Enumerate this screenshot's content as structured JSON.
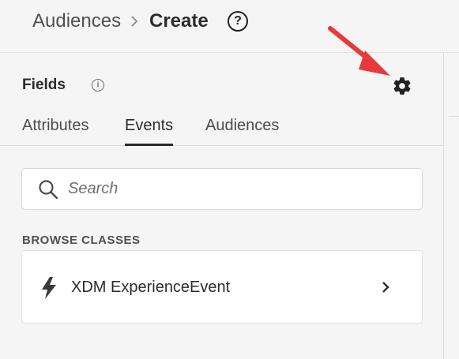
{
  "breadcrumb": {
    "parent": "Audiences",
    "separator_icon": "chevron-right-icon",
    "current": "Create",
    "help_icon": "?"
  },
  "panel": {
    "title": "Fields",
    "info_icon": "i",
    "settings_icon": "gear-icon"
  },
  "tabs": [
    {
      "label": "Attributes",
      "active": false
    },
    {
      "label": "Events",
      "active": true
    },
    {
      "label": "Audiences",
      "active": false
    }
  ],
  "search": {
    "placeholder": "Search",
    "value": ""
  },
  "browse": {
    "section_label": "BROWSE CLASSES",
    "items": [
      {
        "label": "XDM ExperienceEvent",
        "icon": "lightning-bolt-icon",
        "chevron": "chevron-right-icon"
      }
    ]
  },
  "colors": {
    "annotation_arrow": "#e8393b",
    "background": "#f5f5f5",
    "text": "#2c2c2c"
  }
}
